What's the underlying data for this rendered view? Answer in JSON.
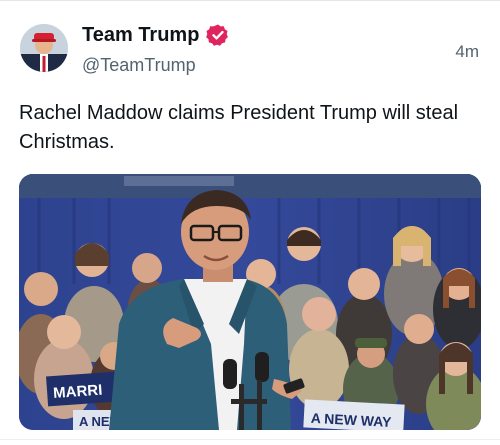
{
  "tweet": {
    "display_name": "Team Trump",
    "handle": "@TeamTrump",
    "timestamp": "4m",
    "text": "Rachel Maddow claims President Trump will steal Christmas."
  },
  "media": {
    "banner_text": "",
    "sign_left_text": "MARRI",
    "sign_right_text": "A NEW WAY",
    "sign_bottom_text": "A NEW"
  },
  "colors": {
    "verified_badge": "#e0245e",
    "backdrop_blue": "#2b3f8c",
    "jacket": "#2e5f79"
  },
  "icons": {
    "verified": "verified-badge-icon"
  }
}
